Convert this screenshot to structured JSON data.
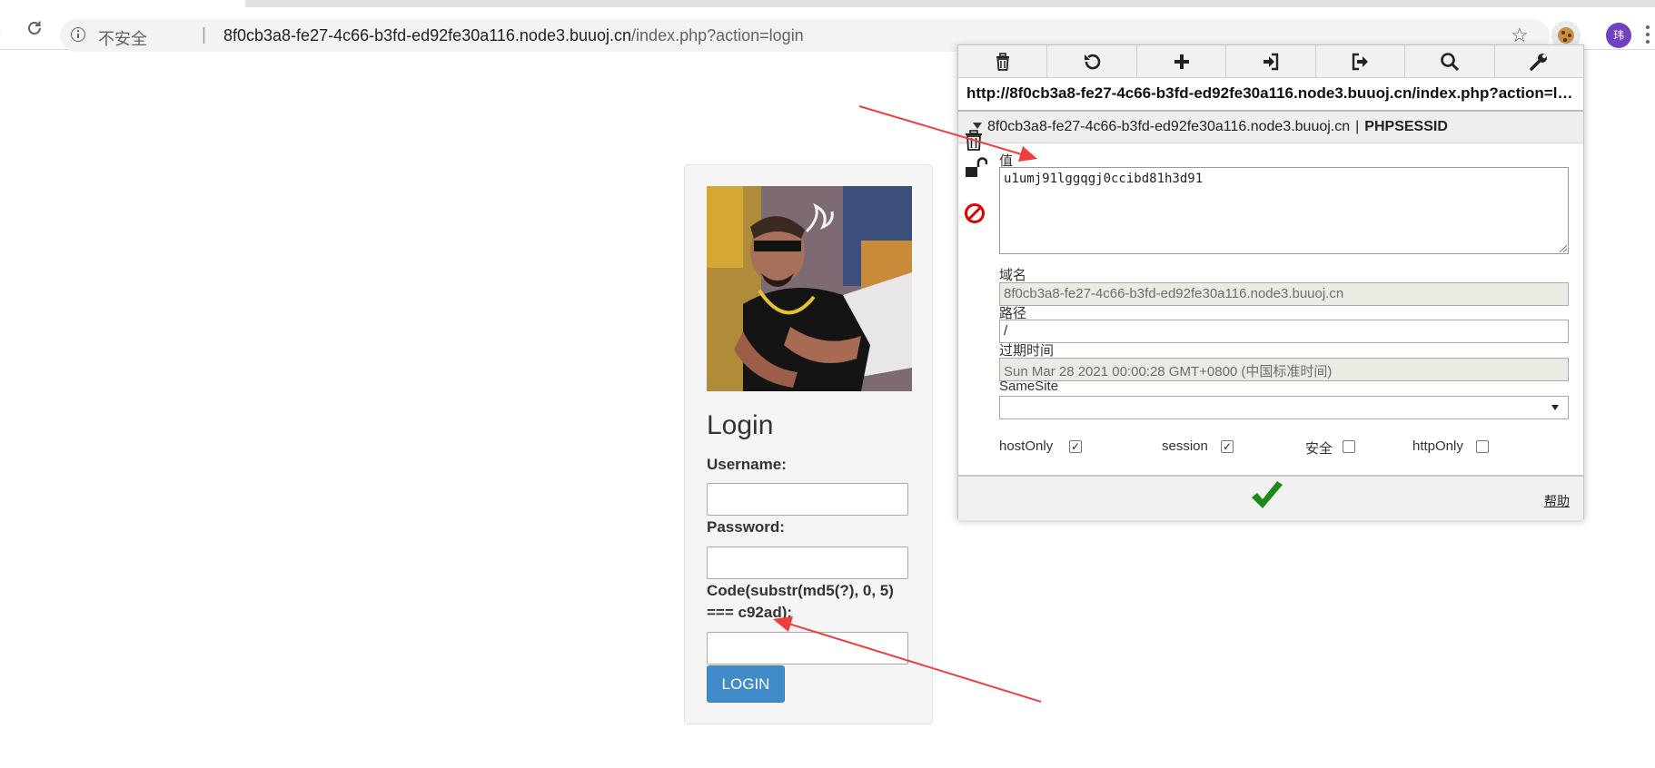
{
  "browser": {
    "insecure_label": "不安全",
    "url_host": "8f0cb3a8-fe27-4c66-b3fd-ed92fe30a116.node3.buuoj.cn",
    "url_path": "/index.php?action=login",
    "avatar_text": "玮",
    "icons": [
      "info-icon",
      "reload-icon",
      "star-icon",
      "cookie-icon",
      "menu-icon"
    ]
  },
  "login": {
    "title": "Login",
    "username_label": "Username:",
    "password_label": "Password:",
    "code_label_line1": "Code(substr(md5(?), 0, 5)",
    "code_label_line2": "=== c92ad):",
    "username_value": "",
    "password_value": "",
    "code_value": "",
    "button_label": "LOGIN"
  },
  "cookie_editor": {
    "toolbar": [
      "trash-icon",
      "undo-icon",
      "plus-icon",
      "import-icon",
      "export-icon",
      "search-icon",
      "wrench-icon"
    ],
    "url": "http://8f0cb3a8-fe27-4c66-b3fd-ed92fe30a116.node3.buuoj.cn/index.php?action=lo...",
    "cookie_domain": "8f0cb3a8-fe27-4c66-b3fd-ed92fe30a116.node3.buuoj.cn",
    "cookie_separator": "|",
    "cookie_name": "PHPSESSID",
    "value_label": "值",
    "value": "u1umj91lggqgj0ccibd81h3d91",
    "domain_label": "域名",
    "domain_value": "8f0cb3a8-fe27-4c66-b3fd-ed92fe30a116.node3.buuoj.cn",
    "path_label": "路径",
    "path_value": "/",
    "expires_label": "过期时间",
    "expires_value": "Sun Mar 28 2021 00:00:28 GMT+0800 (中国标准时间)",
    "samesite_label": "SameSite",
    "samesite_value": "",
    "flags": {
      "host_only_label": "hostOnly",
      "host_only": true,
      "session_label": "session",
      "session": true,
      "secure_label": "安全",
      "secure": false,
      "http_only_label": "httpOnly",
      "http_only": false
    },
    "help_label": "帮助"
  },
  "colors": {
    "login_button": "#428bca",
    "annotation_arrow": "#f03e3e",
    "save_check": "#1a8a1a",
    "block_icon": "#e00000",
    "avatar": "#6f42c1"
  }
}
